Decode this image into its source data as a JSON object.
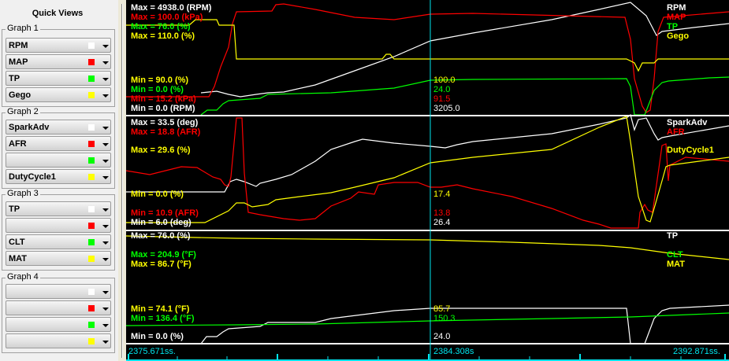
{
  "sidebar": {
    "title": "Quick Views",
    "groups": [
      {
        "label": "Graph 1",
        "items": [
          {
            "label": "RPM",
            "color": "#ffffff"
          },
          {
            "label": "MAP",
            "color": "#ff0000"
          },
          {
            "label": "TP",
            "color": "#00ff00"
          },
          {
            "label": "Gego",
            "color": "#ffff00"
          }
        ]
      },
      {
        "label": "Graph 2",
        "items": [
          {
            "label": "SparkAdv",
            "color": "#ffffff"
          },
          {
            "label": "AFR",
            "color": "#ff0000"
          },
          {
            "label": "",
            "color": "#00ff00"
          },
          {
            "label": "DutyCycle1",
            "color": "#ffff00"
          }
        ]
      },
      {
        "label": "Graph 3",
        "items": [
          {
            "label": "TP",
            "color": "#ffffff"
          },
          {
            "label": "",
            "color": "#ff0000"
          },
          {
            "label": "CLT",
            "color": "#00ff00"
          },
          {
            "label": "MAT",
            "color": "#ffff00"
          }
        ]
      },
      {
        "label": "Graph 4",
        "items": [
          {
            "label": "",
            "color": "#ffffff"
          },
          {
            "label": "",
            "color": "#ff0000"
          },
          {
            "label": "",
            "color": "#00ff00"
          },
          {
            "label": "",
            "color": "#ffff00"
          }
        ]
      }
    ]
  },
  "graphs": [
    {
      "max": [
        "Max = 4938.0 (RPM)",
        "Max = 100.0 (kPa)",
        "Max = 76.0 (%)",
        "Max = 110.0 (%)"
      ],
      "min": [
        "Min = 90.0 (%)",
        "Min = 0.0 (%)",
        "Min = 15.2 (kPa)",
        "Min = 0.0 (RPM)"
      ],
      "names": [
        "RPM",
        "MAP",
        "TP",
        "Gego"
      ],
      "cursor_values": [
        "100.0",
        "24.0",
        "91.5",
        "3205.0"
      ]
    },
    {
      "max": [
        "Max = 33.5 (deg)",
        "Max = 18.8 (AFR)",
        "Max = 29.6 (%)"
      ],
      "min": [
        "Min = 0.0 (%)",
        "Min = 10.9 (AFR)",
        "Min = 6.0 (deg)"
      ],
      "names": [
        "SparkAdv",
        "AFR",
        "DutyCycle1"
      ],
      "cursor_values": [
        "17.4",
        "13.8",
        "26.4"
      ]
    },
    {
      "max": [
        "Max = 76.0 (%)",
        "Max = 204.9 (°F)",
        "Max = 86.7 (°F)"
      ],
      "min": [
        "Min = 74.1 (°F)",
        "Min = 136.4 (°F)",
        "Min = 0.0 (%)"
      ],
      "names": [
        "TP",
        "CLT",
        "MAT"
      ],
      "cursor_values": [
        "85.7",
        "150.3",
        "24.0"
      ]
    }
  ],
  "time_axis": {
    "start": "2375.671ss.",
    "cursor": "2384.308s",
    "end": "2392.871ss."
  },
  "colors": {
    "white": "#ffffff",
    "red": "#ff0000",
    "green": "#00ff00",
    "yellow": "#ffff00",
    "cursor": "#00e5ee"
  }
}
